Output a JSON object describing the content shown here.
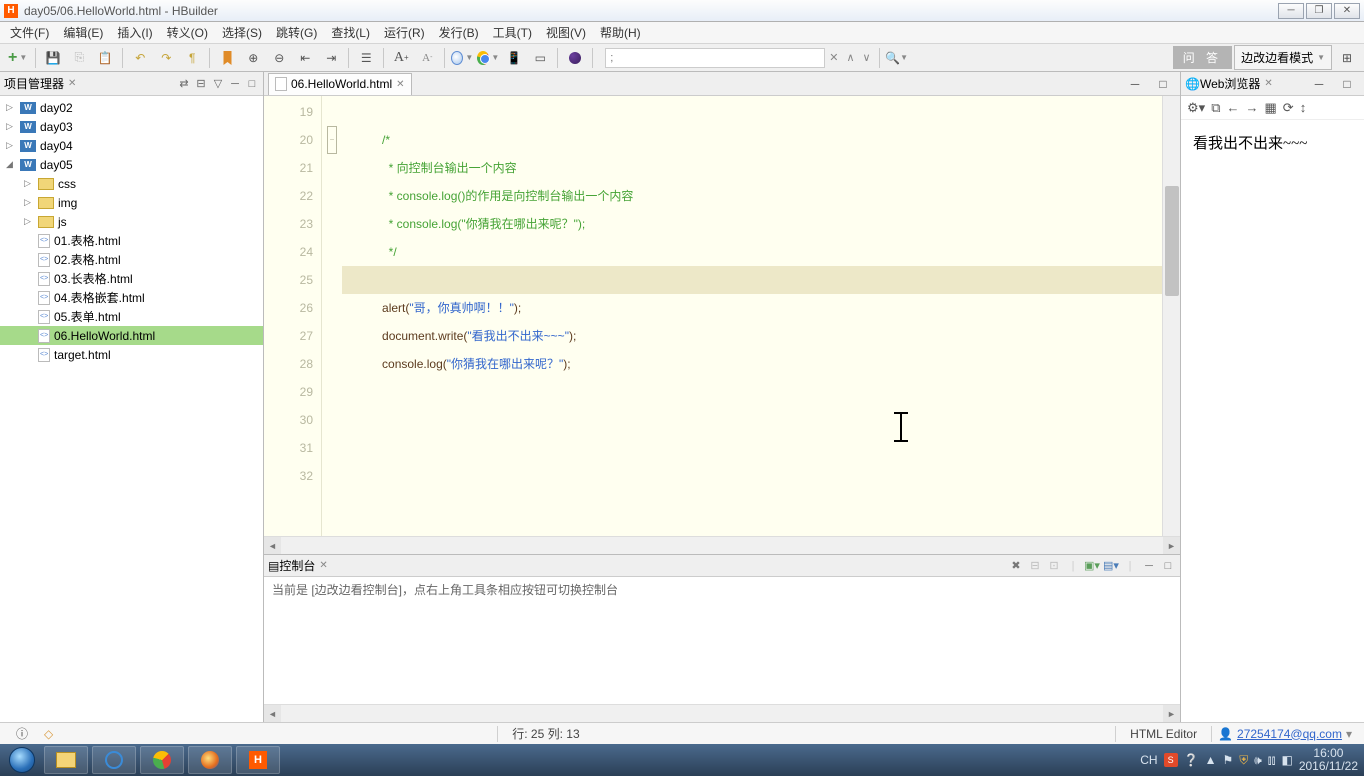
{
  "title": "day05/06.HelloWorld.html  -  HBuilder",
  "app_abbrev": "H",
  "menu": [
    "文件(F)",
    "编辑(E)",
    "插入(I)",
    "转义(O)",
    "选择(S)",
    "跳转(G)",
    "查找(L)",
    "运行(R)",
    "发行(B)",
    "工具(T)",
    "视图(V)",
    "帮助(H)"
  ],
  "toolbar_search_placeholder": ";",
  "qa_button": "问 答",
  "mode_label": "边改边看模式",
  "project_panel": {
    "title": "项目管理器"
  },
  "tree": {
    "roots": [
      {
        "type": "w",
        "label": "day02",
        "expanded": false
      },
      {
        "type": "w",
        "label": "day03",
        "expanded": false
      },
      {
        "type": "w",
        "label": "day04",
        "expanded": false
      },
      {
        "type": "w",
        "label": "day05",
        "expanded": true,
        "children": [
          {
            "type": "folder",
            "label": "css"
          },
          {
            "type": "folder",
            "label": "img"
          },
          {
            "type": "folder",
            "label": "js"
          },
          {
            "type": "html",
            "label": "01.表格.html"
          },
          {
            "type": "html",
            "label": "02.表格.html"
          },
          {
            "type": "html",
            "label": "03.长表格.html"
          },
          {
            "type": "html",
            "label": "04.表格嵌套.html"
          },
          {
            "type": "html",
            "label": "05.表单.html"
          },
          {
            "type": "html",
            "label": "06.HelloWorld.html",
            "selected": true
          },
          {
            "type": "html",
            "label": "target.html"
          }
        ]
      }
    ]
  },
  "editor": {
    "tab_label": "06.HelloWorld.html",
    "first_line": 19,
    "current_line_index": 6,
    "lines": [
      [],
      [
        {
          "cls": "c-comment",
          "txt": "/*"
        }
      ],
      [
        {
          "cls": "c-comment",
          "txt": " * 向控制台输出一个内容"
        }
      ],
      [
        {
          "cls": "c-comment",
          "txt": " * console.log()"
        },
        {
          "cls": "c-comment",
          "txt": "的作用是向控制台输出一个内容"
        }
      ],
      [
        {
          "cls": "c-comment",
          "txt": " * console.log(\"你猜我在哪出来呢？\");"
        }
      ],
      [
        {
          "cls": "c-comment",
          "txt": " */"
        }
      ],
      [],
      [
        {
          "cls": "c-func",
          "txt": "alert"
        },
        {
          "cls": "c-punct",
          "txt": "("
        },
        {
          "cls": "c-str",
          "txt": "\"哥，你真帅啊！！\""
        },
        {
          "cls": "c-punct",
          "txt": ");"
        }
      ],
      [
        {
          "cls": "c-var",
          "txt": "document"
        },
        {
          "cls": "c-punct",
          "txt": "."
        },
        {
          "cls": "c-func",
          "txt": "write"
        },
        {
          "cls": "c-punct",
          "txt": "("
        },
        {
          "cls": "c-str",
          "txt": "\"看我出不出来~~~\""
        },
        {
          "cls": "c-punct",
          "txt": ");"
        }
      ],
      [
        {
          "cls": "c-var",
          "txt": "console"
        },
        {
          "cls": "c-punct",
          "txt": "."
        },
        {
          "cls": "c-func",
          "txt": "log"
        },
        {
          "cls": "c-punct",
          "txt": "("
        },
        {
          "cls": "c-str",
          "txt": "\"你猜我在哪出来呢？\""
        },
        {
          "cls": "c-punct",
          "txt": ");"
        }
      ],
      [],
      [],
      [],
      []
    ],
    "indent": "            ",
    "comment_indent_extra": " "
  },
  "console": {
    "title": "控制台",
    "message": "当前是 [边改边看控制台]，点右上角工具条相应按钮可切换控制台"
  },
  "browser": {
    "title": "Web浏览器",
    "content": "看我出不出来~~~"
  },
  "status": {
    "position": "行: 25 列: 13",
    "editor_type": "HTML Editor",
    "user_email": "27254174@qq.com"
  },
  "systray": {
    "ime": "CH",
    "time": "16:00",
    "date": "2016/11/22"
  }
}
